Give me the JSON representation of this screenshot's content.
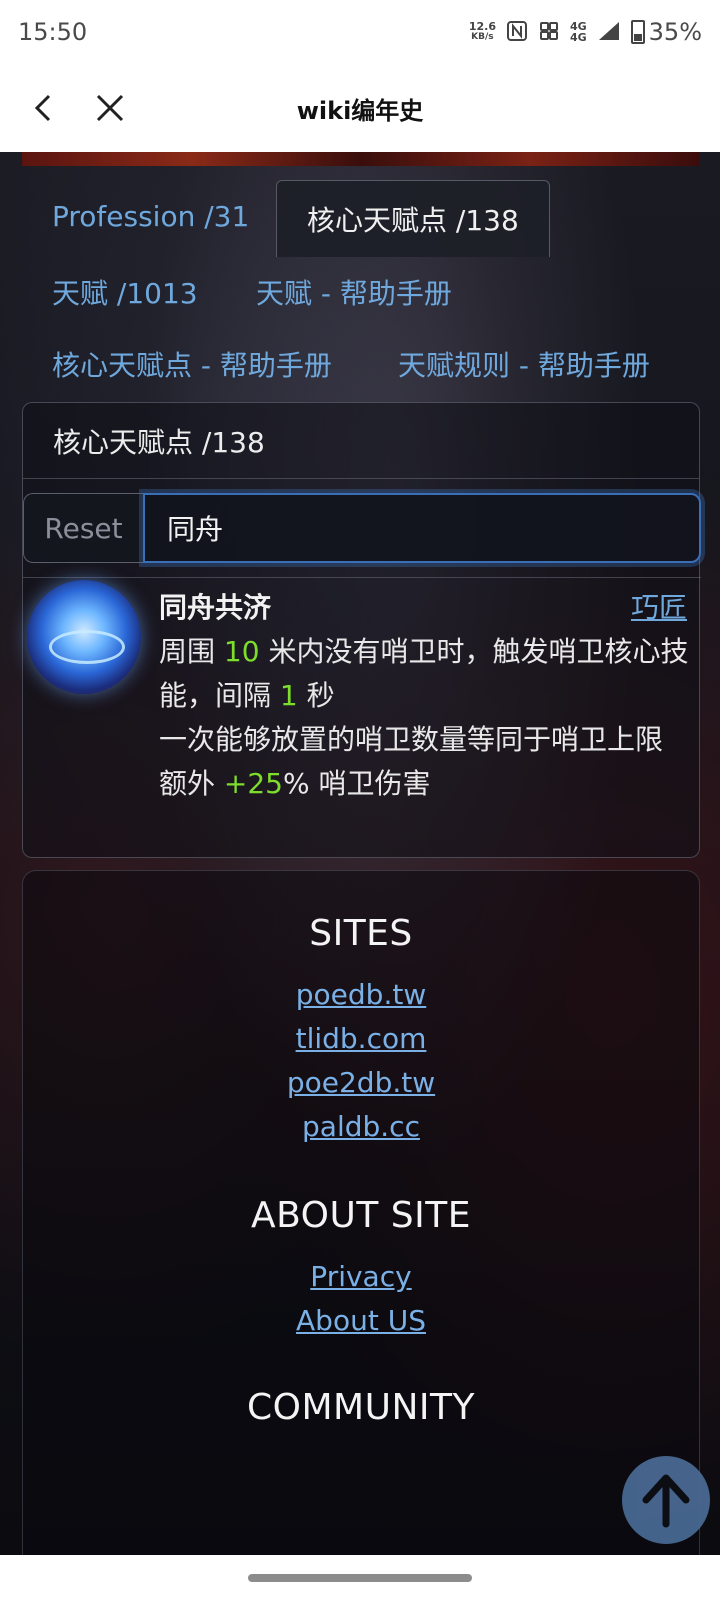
{
  "status_bar": {
    "time": "15:50",
    "net_speed_value": "12.6",
    "net_speed_unit": "KB/s",
    "network_label_1": "4G",
    "network_label_2": "4G",
    "battery": "35%"
  },
  "nav": {
    "title": "wiki编年史"
  },
  "tabs": [
    {
      "label": "Profession /31"
    },
    {
      "label": "核心天赋点 /138"
    },
    {
      "label": "天赋 /1013"
    },
    {
      "label": "天赋 - 帮助手册"
    },
    {
      "label": "核心天赋点 - 帮助手册"
    },
    {
      "label": "天赋规则 - 帮助手册"
    }
  ],
  "panel": {
    "header": "核心天赋点 /138",
    "reset_label": "Reset",
    "search_value": "同舟"
  },
  "result": {
    "name": "同舟共济",
    "class_link": "巧匠",
    "line1_a": "周围 ",
    "line1_num": "10",
    "line1_b": " 米内没有哨卫时，触发哨卫核心技能，间隔 ",
    "line1_num2": "1",
    "line1_c": " 秒",
    "line2": "一次能够放置的哨卫数量等同于哨卫上限",
    "line3_a": "额外 ",
    "line3_num": "+25",
    "line3_b": "% 哨卫伤害"
  },
  "footer": {
    "sites_title": "SITES",
    "sites": [
      "poedb.tw",
      "tlidb.com",
      "poe2db.tw",
      "paldb.cc"
    ],
    "about_title": "ABOUT SITE",
    "about_links": [
      "Privacy",
      "About US"
    ],
    "community_title": "COMMUNITY"
  },
  "colors": {
    "link": "#6fa8dc",
    "number_highlight": "#7ddc2c",
    "search_focus": "#3a6fb8",
    "scroll_top_button": "#4a6b96"
  },
  "icons": {
    "back": "chevron-left-icon",
    "close": "close-icon",
    "scroll_top": "arrow-up-icon",
    "result": "talent-orb-icon"
  }
}
